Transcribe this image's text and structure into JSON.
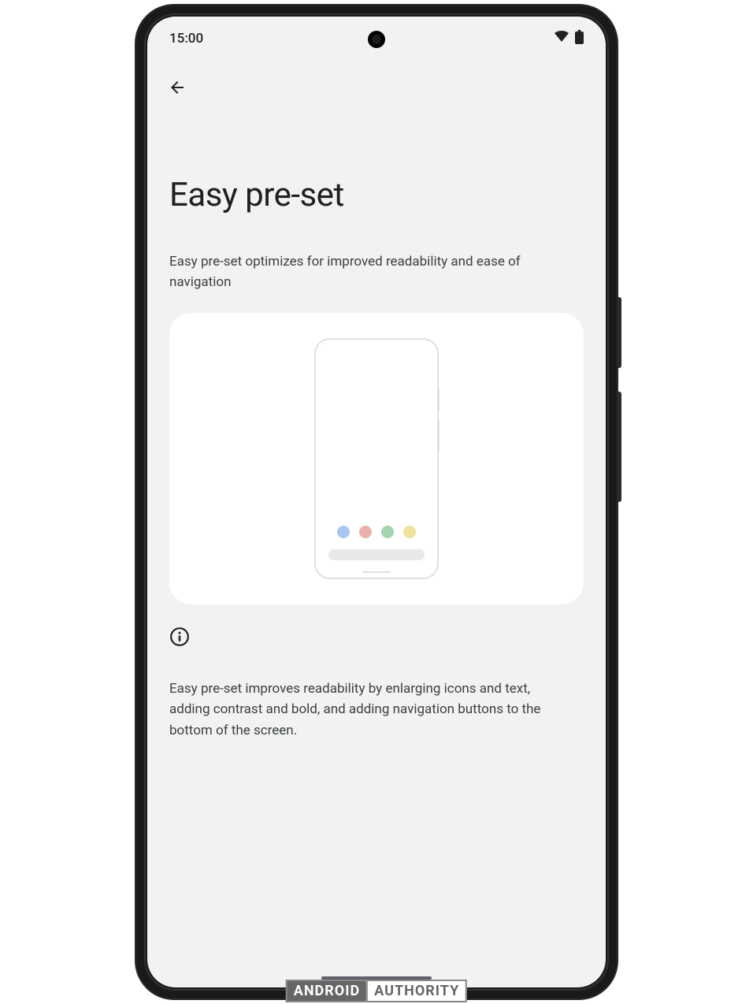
{
  "statusBar": {
    "time": "15:00"
  },
  "page": {
    "title": "Easy pre-set",
    "subtitle": "Easy pre-set optimizes for improved readability and ease of navigation",
    "infoText": "Easy pre-set improves readability by enlarging icons and text, adding contrast and bold, and adding navigation buttons to the bottom of the screen."
  },
  "watermark": {
    "part1": "ANDROID",
    "part2": "AUTHORITY"
  }
}
